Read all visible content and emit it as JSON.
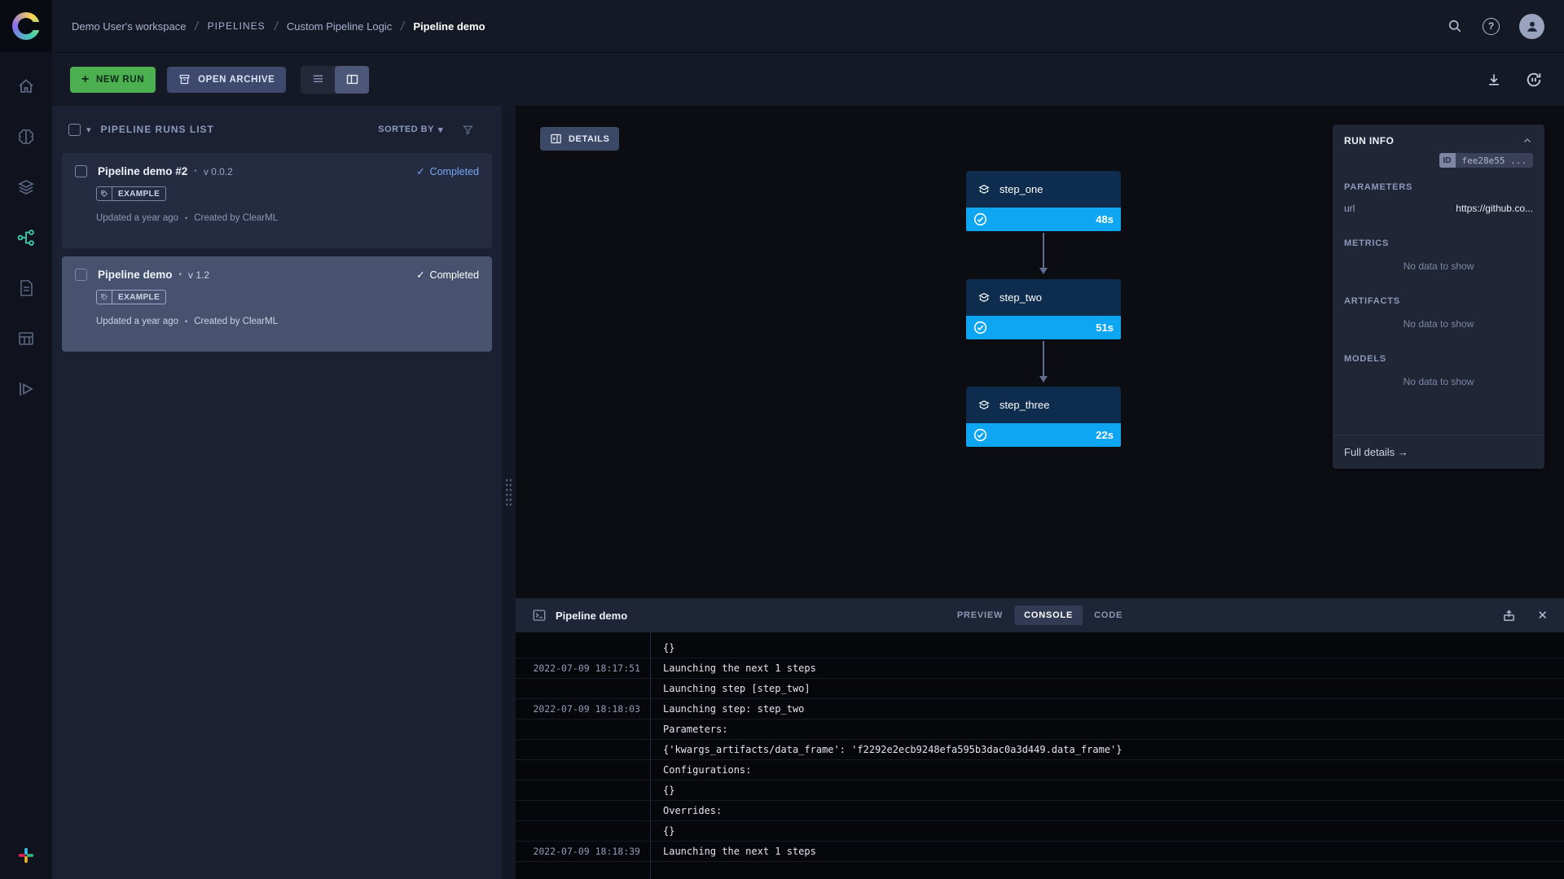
{
  "colors": {
    "accent-green": "#4caf50",
    "accent-blue": "#0ea6f3",
    "status-blue": "#77a7f5",
    "node-header-bg": "#0e2d4e",
    "selected-card-bg": "#47526f",
    "pipelines-active": "#3ecfae"
  },
  "glyphs": {
    "caret_down": "▾",
    "check": "✓",
    "bullet": "•",
    "close": "✕",
    "question": "?",
    "plus": "+"
  },
  "header": {
    "separator": "/",
    "breadcrumbs": [
      "Demo User's workspace",
      "PIPELINES",
      "Custom Pipeline Logic",
      "Pipeline demo"
    ]
  },
  "toolbar": {
    "new_run": "NEW RUN",
    "open_archive": "OPEN ARCHIVE"
  },
  "runs_list": {
    "title": "PIPELINE RUNS LIST",
    "sorted_by": "SORTED BY",
    "runs": [
      {
        "name": "Pipeline demo #2",
        "version": "v 0.0.2",
        "status": "Completed",
        "tag": "EXAMPLE",
        "updated": "Updated a year ago",
        "created": "Created by ClearML"
      },
      {
        "name": "Pipeline demo",
        "version": "v 1.2",
        "status": "Completed",
        "tag": "EXAMPLE",
        "updated": "Updated a year ago",
        "created": "Created by ClearML"
      }
    ]
  },
  "canvas": {
    "details": "DETAILS",
    "steps": [
      {
        "name": "step_one",
        "duration": "48s"
      },
      {
        "name": "step_two",
        "duration": "51s"
      },
      {
        "name": "step_three",
        "duration": "22s"
      }
    ]
  },
  "run_info": {
    "title": "RUN INFO",
    "id_label": "ID",
    "id_value": "fee28e55 ...",
    "parameters_title": "PARAMETERS",
    "param_key": "url",
    "param_value": "https://github.co...",
    "metrics_title": "METRICS",
    "artifacts_title": "ARTIFACTS",
    "models_title": "MODELS",
    "no_data": "No data to show",
    "full_details": "Full details →"
  },
  "console": {
    "title": "Pipeline demo",
    "tabs": [
      "PREVIEW",
      "CONSOLE",
      "CODE"
    ],
    "rows": [
      {
        "time": "",
        "text": "{}"
      },
      {
        "time": "2022-07-09 18:17:51",
        "text": "Launching the next 1 steps"
      },
      {
        "time": "",
        "text": "Launching step [step_two]"
      },
      {
        "time": "2022-07-09 18:18:03",
        "text": "Launching step: step_two"
      },
      {
        "time": "",
        "text": "Parameters:"
      },
      {
        "time": "",
        "text": "{'kwargs_artifacts/data_frame': 'f2292e2ecb9248efa595b3dac0a3d449.data_frame'}"
      },
      {
        "time": "",
        "text": "Configurations:"
      },
      {
        "time": "",
        "text": "{}"
      },
      {
        "time": "",
        "text": "Overrides:"
      },
      {
        "time": "",
        "text": "{}"
      },
      {
        "time": "2022-07-09 18:18:39",
        "text": "Launching the next 1 steps"
      }
    ]
  }
}
